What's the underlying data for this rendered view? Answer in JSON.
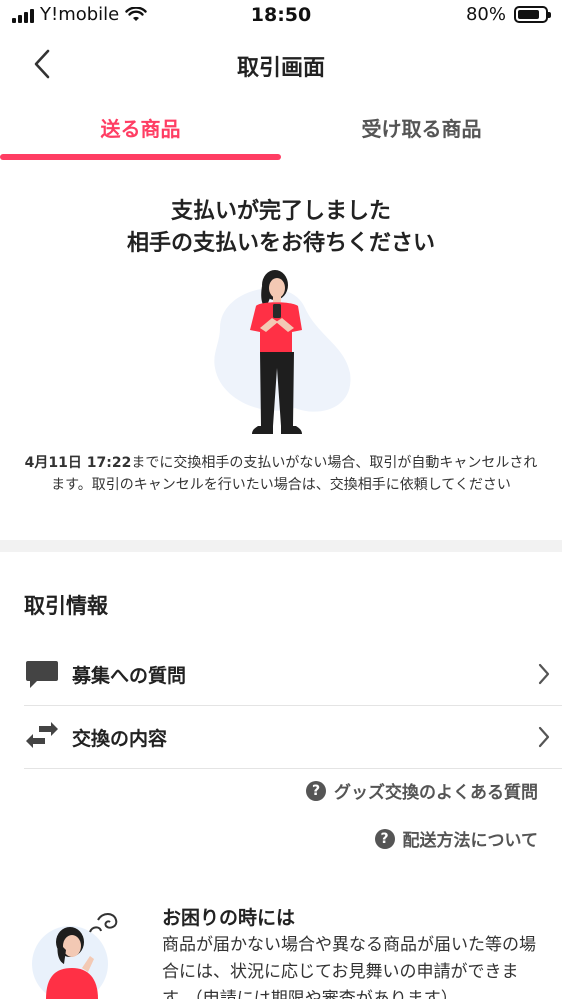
{
  "status_bar": {
    "carrier": "Y!mobile",
    "time": "18:50",
    "battery_percent": "80%",
    "battery_level": 0.8
  },
  "header": {
    "title": "取引画面"
  },
  "tabs": [
    {
      "label": "送る商品",
      "active": true
    },
    {
      "label": "受け取る商品",
      "active": false
    }
  ],
  "status": {
    "line1": "支払いが完了しました",
    "line2": "相手の支払いをお待ちください"
  },
  "notice": {
    "deadline": "4月11日 17:22",
    "text": "までに交換相手の支払いがない場合、取引が自動キャンセルされます。取引のキャンセルを行いたい場合は、交換相手に依頼してください"
  },
  "transaction_info": {
    "title": "取引情報",
    "rows": [
      {
        "label": "募集への質問",
        "icon": "speech-bubble-icon"
      },
      {
        "label": "交換の内容",
        "icon": "exchange-arrows-icon"
      }
    ]
  },
  "help_links": [
    {
      "label": "グッズ交換のよくある質問",
      "icon": "question-circle-icon"
    },
    {
      "label": "配送方法について",
      "icon": "question-circle-icon"
    }
  ],
  "trouble": {
    "title": "お困りの時には",
    "text": "商品が届かない場合や異なる商品が届いた等の場合には、状況に応じてお見舞いの申請ができます。（申請には期限や審査があります）"
  },
  "colors": {
    "accent": "#ff3d63",
    "text": "#222222",
    "muted": "#555555"
  }
}
